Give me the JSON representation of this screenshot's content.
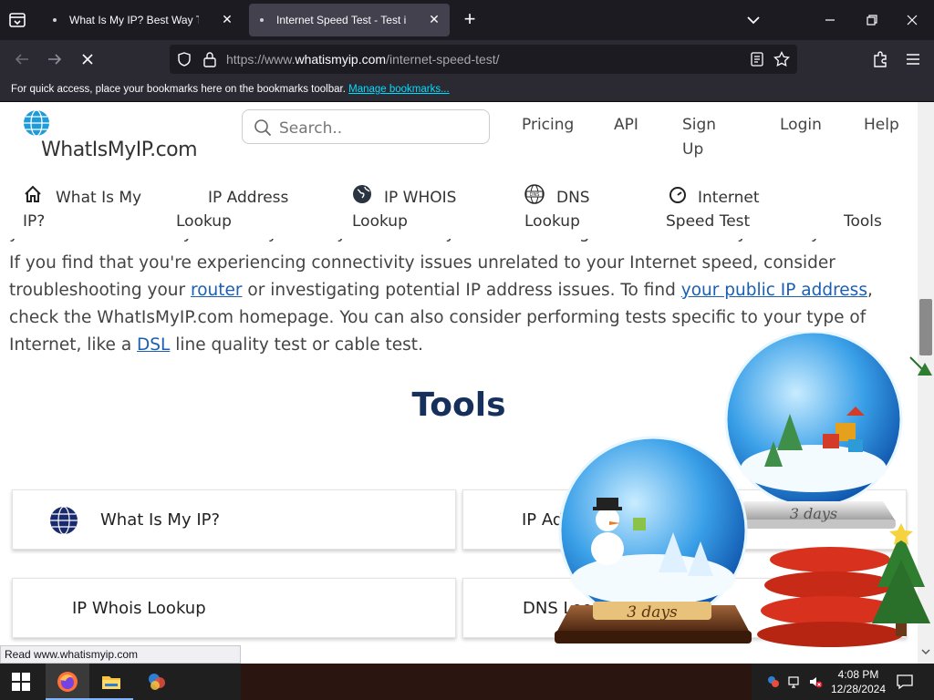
{
  "browser": {
    "tabs": [
      {
        "title": "What Is My IP? Best Way To Check Your Public IP Address",
        "active": false
      },
      {
        "title": "Internet Speed Test - Test internet speed",
        "active": true
      }
    ],
    "url_prefix": "https://www.",
    "url_domain": "whatismyip.com",
    "url_path": "/internet-speed-test/",
    "bookmarks_prompt": "For quick access, place your bookmarks here on the bookmarks toolbar.",
    "bookmarks_link": "Manage bookmarks..."
  },
  "site": {
    "logo_text": "WhatIsMyIP.com",
    "search_placeholder": "Search..",
    "header_links": {
      "pricing": "Pricing",
      "api": "API",
      "signup": "Sign Up",
      "login": "Login",
      "help": "Help"
    },
    "main_nav": [
      {
        "label": "What Is My IP?",
        "icon": "home-icon"
      },
      {
        "label": "IP Address Lookup",
        "icon": "none"
      },
      {
        "label": "IP WHOIS Lookup",
        "icon": "globe-icon"
      },
      {
        "label": "DNS Lookup",
        "icon": "dns-globe-icon"
      },
      {
        "label": "Internet Speed Test",
        "icon": "speedometer-icon"
      },
      {
        "label": "Tools",
        "icon": "none"
      }
    ]
  },
  "content": {
    "cut_line": "you if have the ability to readily identify connectivity issues that might arise between you and your ISP.",
    "p1": "If you find that you're experiencing connectivity issues unrelated to your Internet speed, consider troubleshooting your",
    "link_router": "router",
    "p2": "or investigating potential IP address issues. To find",
    "link_public_ip": "your public IP address",
    "p3": ", check the WhatIsMyIP.com homepage.  You can also consider performing tests specific to your type of Internet, like a",
    "link_dsl": "DSL",
    "p4": "line quality test or cable test.",
    "tools_heading": "Tools",
    "tool_cards": [
      "What Is My IP?",
      "IP Address Lookup",
      "IP Whois Lookup",
      "DNS Lookup"
    ]
  },
  "decoration": {
    "badge_text": "3 days"
  },
  "status_bar": "Read www.whatismyip.com",
  "taskbar": {
    "time": "4:08 PM",
    "date": "12/28/2024"
  },
  "colors": {
    "accent_link": "#1a5fb4",
    "heading": "#16305b",
    "chrome_dark": "#1c1b22",
    "bookmark_link": "#00ddff"
  }
}
